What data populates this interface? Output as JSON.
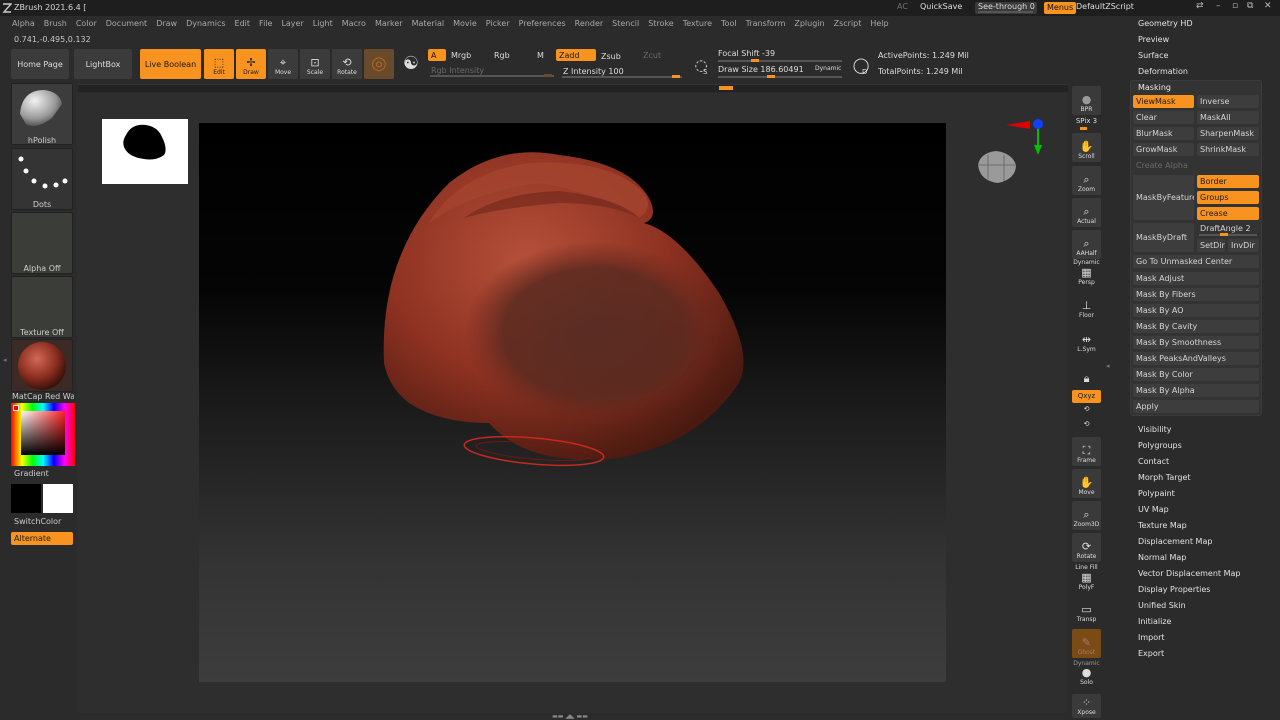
{
  "app": {
    "title": "ZBrush 2021.6.4 [",
    "ac": "AC",
    "quicksave": "QuickSave",
    "seethrough": "See-through   0",
    "menus": "Menus",
    "default_zscript": "DefaultZScript"
  },
  "menu_bar": [
    "Alpha",
    "Brush",
    "Color",
    "Document",
    "Draw",
    "Dynamics",
    "Edit",
    "File",
    "Layer",
    "Light",
    "Macro",
    "Marker",
    "Material",
    "Movie",
    "Picker",
    "Preferences",
    "Render",
    "Stencil",
    "Stroke",
    "Texture",
    "Tool",
    "Transform",
    "Zplugin",
    "Zscript",
    "Help"
  ],
  "coords": "0.741,-0.495,0.132",
  "shelf": {
    "home_page": "Home Page",
    "lightbox": "LightBox",
    "live_boolean": "Live Boolean",
    "edit": "Edit",
    "draw": "Draw",
    "move": "Move",
    "scale": "Scale",
    "rotate": "Rotate",
    "a": "A",
    "mrgb": "Mrgb",
    "rgb": "Rgb",
    "m": "M",
    "zadd": "Zadd",
    "zsub": "Zsub",
    "zcut": "Zcut",
    "rgb_intensity": "Rgb Intensity",
    "z_intensity": "Z Intensity 100",
    "focal_shift": "Focal Shift -39",
    "draw_size": "Draw Size 186.60491",
    "dynamic": "Dynamic",
    "active_points": "ActivePoints: 1.249 Mil",
    "total_points": "TotalPoints: 1.249 Mil",
    "s_label": "S",
    "d_label": "D"
  },
  "left_panel": {
    "brush": "hPolish",
    "stroke": "Dots",
    "alpha": "Alpha Off",
    "texture": "Texture Off",
    "material": "MatCap Red Wax",
    "gradient": "Gradient",
    "switchcolor": "SwitchColor",
    "alternate": "Alternate"
  },
  "right_tools": {
    "bpr": "BPR",
    "spix": "SPix 3",
    "scroll": "Scroll",
    "zoom": "Zoom",
    "actual": "Actual",
    "aahalf": "AAHalf",
    "dynamic": "Dynamic",
    "persp": "Persp",
    "floor": "Floor",
    "lsym": "L.Sym",
    "xyz": "Qxyz",
    "frame": "Frame",
    "move": "Move",
    "zoom3d": "Zoom3D",
    "rotate": "Rotate",
    "line_fill": "Line Fill",
    "polyf": "PolyF",
    "transp": "Transp",
    "ghost": "Ghost",
    "dynamic2": "Dynamic",
    "solo": "Solo",
    "xpose": "Xpose"
  },
  "right_menu": {
    "top_items": [
      "Geometry HD",
      "Preview",
      "Surface",
      "Deformation"
    ],
    "masking": {
      "title": "Masking",
      "viewmask": "ViewMask",
      "inverse": "Inverse",
      "clear": "Clear",
      "maskall": "MaskAll",
      "blurmask": "BlurMask",
      "sharpenmask": "SharpenMask",
      "growmask": "GrowMask",
      "shrinkmask": "ShrinkMask",
      "create_alpha": "Create Alpha",
      "maskbyfeature": "MaskByFeature",
      "border": "Border",
      "groups": "Groups",
      "crease": "Crease",
      "maskbydraft": "MaskByDraft",
      "draftangle": "DraftAngle 2",
      "setdir": "SetDir",
      "invdir": "InvDir",
      "goto_unmasked": "Go To Unmasked Center",
      "list": [
        "Mask Adjust",
        "Mask By Fibers",
        "Mask By AO",
        "Mask By Cavity",
        "Mask By Smoothness",
        "Mask PeaksAndValleys",
        "Mask By Color",
        "Mask By Alpha",
        "Apply"
      ]
    },
    "bottom_items": [
      "Visibility",
      "Polygroups",
      "Contact",
      "Morph Target",
      "Polypaint",
      "UV Map",
      "Texture Map",
      "Displacement Map",
      "Normal Map",
      "Vector Displacement Map",
      "Display Properties",
      "Unified Skin",
      "Initialize",
      "Import",
      "Export"
    ]
  },
  "colors": {
    "accent": "#f7931e",
    "model": "#9a3a2a"
  }
}
